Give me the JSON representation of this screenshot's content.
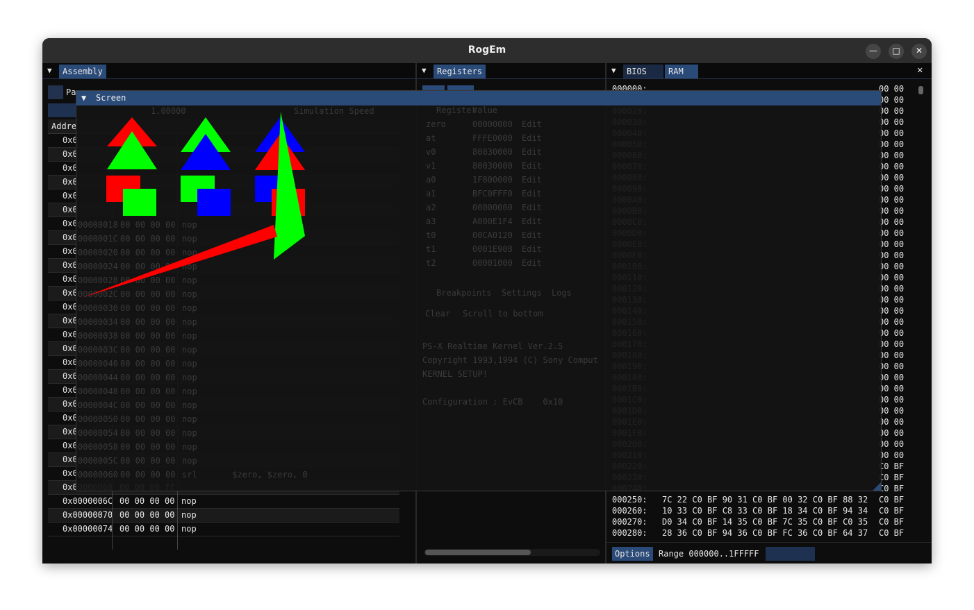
{
  "window": {
    "title": "RogEm"
  },
  "assembly": {
    "tab": "Assembly",
    "pause_label": "Pa",
    "header_label": "Addre",
    "rows": [
      {
        "addr": "0x0",
        "bytes": "",
        "instr": ""
      },
      {
        "addr": "0x0",
        "bytes": "",
        "instr": ""
      },
      {
        "addr": "0x0",
        "bytes": "",
        "instr": ""
      },
      {
        "addr": "0x0",
        "bytes": "",
        "instr": ""
      },
      {
        "addr": "0x0",
        "bytes": "",
        "instr": ""
      },
      {
        "addr": "0x0",
        "bytes": "",
        "instr": ""
      },
      {
        "addr": "0x0",
        "bytes": "",
        "instr": ""
      },
      {
        "addr": "0x0",
        "bytes": "",
        "instr": ""
      },
      {
        "addr": "0x0",
        "bytes": "",
        "instr": ""
      },
      {
        "addr": "0x0",
        "bytes": "",
        "instr": ""
      },
      {
        "addr": "0x0",
        "bytes": "",
        "instr": ""
      },
      {
        "addr": "0x0",
        "bytes": "",
        "instr": ""
      },
      {
        "addr": "0x0",
        "bytes": "",
        "instr": ""
      },
      {
        "addr": "0x0",
        "bytes": "",
        "instr": ""
      },
      {
        "addr": "0x0",
        "bytes": "",
        "instr": ""
      },
      {
        "addr": "0x0",
        "bytes": "",
        "instr": ""
      },
      {
        "addr": "0x0",
        "bytes": "",
        "instr": ""
      },
      {
        "addr": "0x0",
        "bytes": "",
        "instr": ""
      },
      {
        "addr": "0x0",
        "bytes": "",
        "instr": ""
      },
      {
        "addr": "0x0",
        "bytes": "",
        "instr": ""
      },
      {
        "addr": "0x0",
        "bytes": "",
        "instr": ""
      },
      {
        "addr": "0x0",
        "bytes": "",
        "instr": ""
      },
      {
        "addr": "0x0",
        "bytes": "",
        "instr": ""
      },
      {
        "addr": "0x0",
        "bytes": "",
        "instr": ""
      },
      {
        "addr": "0x0",
        "bytes": "",
        "instr": ""
      },
      {
        "addr": "0x00000068",
        "bytes": "00 00 00 ff",
        "instr": ""
      },
      {
        "addr": "0x0000006C",
        "bytes": "00 00 00 00",
        "instr": "nop"
      },
      {
        "addr": "0x00000070",
        "bytes": "00 00 00 00",
        "instr": "nop"
      },
      {
        "addr": "0x00000074",
        "bytes": "00 00 00 00",
        "instr": "nop"
      }
    ]
  },
  "registers": {
    "tab": "Registers"
  },
  "memory": {
    "tabs": [
      "BIOS",
      "RAM"
    ],
    "rows": [
      {
        "addr": "000000:",
        "bytes": "",
        "tail": "00 00"
      },
      {
        "addr": "",
        "bytes": "",
        "tail": "00 00"
      },
      {
        "addr": "000020:",
        "bytes": "",
        "tail": "00 00"
      },
      {
        "addr": "000030:",
        "bytes": "",
        "tail": "00 00"
      },
      {
        "addr": "000040:",
        "bytes": "",
        "tail": "00 00"
      },
      {
        "addr": "000050:",
        "bytes": "",
        "tail": "00 00"
      },
      {
        "addr": "000060:",
        "bytes": "",
        "tail": "00 00"
      },
      {
        "addr": "000070:",
        "bytes": "",
        "tail": "00 00"
      },
      {
        "addr": "000080:",
        "bytes": "",
        "tail": "00 00"
      },
      {
        "addr": "000090:",
        "bytes": "",
        "tail": "00 00"
      },
      {
        "addr": "0000A0:",
        "bytes": "",
        "tail": "00 00"
      },
      {
        "addr": "0000B0:",
        "bytes": "",
        "tail": "00 00"
      },
      {
        "addr": "0000C0:",
        "bytes": "",
        "tail": "00 00"
      },
      {
        "addr": "0000D0:",
        "bytes": "",
        "tail": "00 00"
      },
      {
        "addr": "0000E0:",
        "bytes": "",
        "tail": "00 00"
      },
      {
        "addr": "0000F0:",
        "bytes": "",
        "tail": "00 00"
      },
      {
        "addr": "000100:",
        "bytes": "",
        "tail": "00 00"
      },
      {
        "addr": "000110:",
        "bytes": "",
        "tail": "00 00"
      },
      {
        "addr": "000120:",
        "bytes": "",
        "tail": "00 00"
      },
      {
        "addr": "000130:",
        "bytes": "",
        "tail": "00 00"
      },
      {
        "addr": "000140:",
        "bytes": "",
        "tail": "00 00"
      },
      {
        "addr": "000150:",
        "bytes": "",
        "tail": "00 00"
      },
      {
        "addr": "000160:",
        "bytes": "",
        "tail": "00 00"
      },
      {
        "addr": "000170:",
        "bytes": "",
        "tail": "00 00"
      },
      {
        "addr": "000180:",
        "bytes": "",
        "tail": "00 00"
      },
      {
        "addr": "000190:",
        "bytes": "",
        "tail": "00 00"
      },
      {
        "addr": "0001A0:",
        "bytes": "",
        "tail": "00 00"
      },
      {
        "addr": "0001B0:",
        "bytes": "",
        "tail": "00 00"
      },
      {
        "addr": "0001C0:",
        "bytes": "",
        "tail": "00 00"
      },
      {
        "addr": "0001D0:",
        "bytes": "",
        "tail": "00 00"
      },
      {
        "addr": "0001E0:",
        "bytes": "",
        "tail": "00 00"
      },
      {
        "addr": "0001F0:",
        "bytes": "",
        "tail": "00 00"
      },
      {
        "addr": "000200:",
        "bytes": "",
        "tail": "00 00"
      },
      {
        "addr": "000210:",
        "bytes": "",
        "tail": "00 00"
      },
      {
        "addr": "000220:",
        "bytes": "",
        "tail": "C0 BF"
      },
      {
        "addr": "000230:",
        "bytes": "",
        "tail": "C0 BF"
      },
      {
        "addr": "000240:",
        "bytes": "",
        "tail": "C0 BF"
      },
      {
        "addr": "000250:",
        "bytes": "7C 22 C0 BF 90 31 C0 BF 00 32 C0 BF 88 32",
        "tail": "C0 BF"
      },
      {
        "addr": "000260:",
        "bytes": "10 33 C0 BF C8 33 C0 BF 18 34 C0 BF 94 34",
        "tail": "C0 BF"
      },
      {
        "addr": "000270:",
        "bytes": "D0 34 C0 BF 14 35 C0 BF 7C 35 C0 BF C0 35",
        "tail": "C0 BF"
      },
      {
        "addr": "000280:",
        "bytes": "28 36 C0 BF 94 36 C0 BF FC 36 C0 BF 64 37",
        "tail": "C0 BF"
      }
    ],
    "options_label": "Options",
    "range_label": "Range 000000..1FFFFF"
  },
  "screen": {
    "title": "Screen",
    "speed_value": "1.00000",
    "speed_label": "Simulation Speed",
    "log_lines": [
      "PS-X Realtime Kernel Ver.2.5",
      "Copyright 1993,1994 (C) Sony Comput",
      "KERNEL SETUP!",
      "",
      "Configuration : EvCB    0x10"
    ],
    "ghost_tabs": [
      "Breakpoints",
      "Settings",
      "Logs"
    ],
    "ghost_buttons": [
      "Clear",
      "Scroll to bottom"
    ],
    "ghost_reg_header": [
      "Register",
      "Value"
    ],
    "ghost_regs": [
      {
        "name": "zero",
        "value": "00000000",
        "btn": "Edit"
      },
      {
        "name": "at",
        "value": "FFFE0000",
        "btn": "Edit"
      },
      {
        "name": "v0",
        "value": "80030000",
        "btn": "Edit"
      },
      {
        "name": "v1",
        "value": "80030000",
        "btn": "Edit"
      },
      {
        "name": "a0",
        "value": "1F800000",
        "btn": "Edit"
      },
      {
        "name": "a1",
        "value": "BFC0FFF0",
        "btn": "Edit"
      },
      {
        "name": "a2",
        "value": "00000000",
        "btn": "Edit"
      },
      {
        "name": "a3",
        "value": "A000E1F4",
        "btn": "Edit"
      },
      {
        "name": "t0",
        "value": "00CA0120",
        "btn": "Edit"
      },
      {
        "name": "t1",
        "value": "0001E908",
        "btn": "Edit"
      },
      {
        "name": "t2",
        "value": "00001000",
        "btn": "Edit"
      }
    ],
    "ghost_asm_rows": [
      {
        "addr": "00000018",
        "bytes": "00 00 00 00",
        "instr": "nop"
      },
      {
        "addr": "0000001C",
        "bytes": "00 00 00 00",
        "instr": "nop"
      },
      {
        "addr": "00000020",
        "bytes": "00 00 00 00",
        "instr": "nop"
      },
      {
        "addr": "00000024",
        "bytes": "00 00 00 00",
        "instr": "nop"
      },
      {
        "addr": "00000028",
        "bytes": "00 00 00 00",
        "instr": "nop"
      },
      {
        "addr": "0000002C",
        "bytes": "00 00 00 00",
        "instr": "nop"
      },
      {
        "addr": "00000030",
        "bytes": "00 00 00 00",
        "instr": "nop"
      },
      {
        "addr": "00000034",
        "bytes": "00 00 00 00",
        "instr": "nop"
      },
      {
        "addr": "00000038",
        "bytes": "00 00 00 00",
        "instr": "nop"
      },
      {
        "addr": "0000003C",
        "bytes": "00 00 00 00",
        "instr": "nop"
      },
      {
        "addr": "00000040",
        "bytes": "00 00 00 00",
        "instr": "nop"
      },
      {
        "addr": "00000044",
        "bytes": "00 00 00 00",
        "instr": "nop"
      },
      {
        "addr": "00000048",
        "bytes": "00 00 00 00",
        "instr": "nop"
      },
      {
        "addr": "0000004C",
        "bytes": "00 00 00 00",
        "instr": "nop"
      },
      {
        "addr": "00000050",
        "bytes": "00 00 00 00",
        "instr": "nop"
      },
      {
        "addr": "00000054",
        "bytes": "00 00 00 00",
        "instr": "nop"
      },
      {
        "addr": "00000058",
        "bytes": "00 00 00 00",
        "instr": "nop"
      },
      {
        "addr": "0000005C",
        "bytes": "00 00 00 00",
        "instr": "nop"
      },
      {
        "addr": "00000060",
        "bytes": "00 00 00 00",
        "instr": "srl       $zero, $zero, 0"
      }
    ]
  },
  "colors": {
    "accent": "#2a4a78",
    "red": "#ff0000",
    "green": "#00ff00",
    "blue": "#0000ff"
  }
}
